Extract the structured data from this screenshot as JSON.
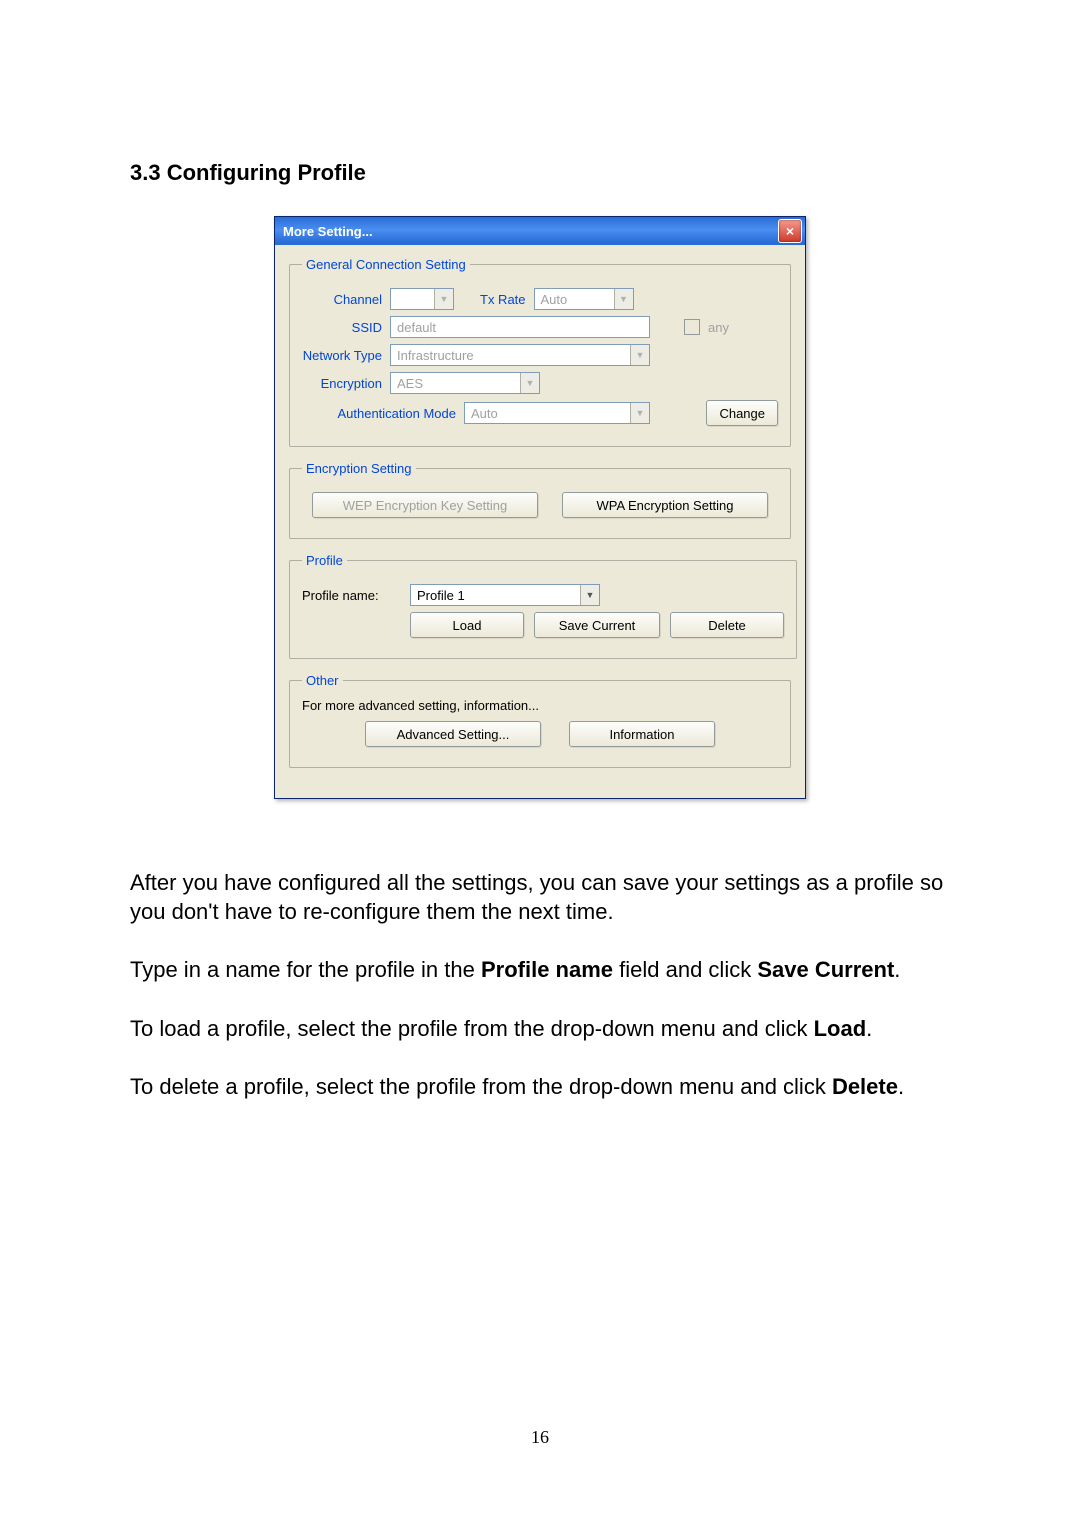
{
  "heading": "3.3 Configuring Profile",
  "dialog": {
    "title": "More Setting...",
    "close_icon_label": "×",
    "gcs": {
      "legend": "General Connection Setting",
      "channel_label": "Channel",
      "channel_value": "",
      "tx_rate_label": "Tx Rate",
      "tx_rate_value": "Auto",
      "ssid_label": "SSID",
      "ssid_value": "default",
      "any_label": "any",
      "network_type_label": "Network Type",
      "network_type_value": "Infrastructure",
      "encryption_label": "Encryption",
      "encryption_value": "AES",
      "auth_mode_label": "Authentication Mode",
      "auth_mode_value": "Auto",
      "change_btn": "Change"
    },
    "enc": {
      "legend": "Encryption Setting",
      "wep_btn": "WEP Encryption Key Setting",
      "wpa_btn": "WPA Encryption Setting"
    },
    "profile": {
      "legend": "Profile",
      "name_label": "Profile name:",
      "name_value": "Profile 1",
      "load_btn": "Load",
      "save_btn": "Save Current",
      "delete_btn": "Delete"
    },
    "other": {
      "legend": "Other",
      "desc": "For more advanced setting, information...",
      "adv_btn": "Advanced Setting...",
      "info_btn": "Information"
    }
  },
  "para1": "After you have configured all the settings, you can save your settings as a profile so you don't have to re-configure them the next time.",
  "para2_a": "Type in a name for the profile in the ",
  "para2_b": "Profile name",
  "para2_c": " field and click ",
  "para2_d": "Save Current",
  "para2_e": ".",
  "para3_a": "To load a profile, select the profile from the drop-down menu and click ",
  "para3_b": "Load",
  "para3_c": ".",
  "para4_a": "To delete a profile, select the profile from the drop-down menu and click ",
  "para4_b": "Delete",
  "para4_c": ".",
  "page_number": "16"
}
